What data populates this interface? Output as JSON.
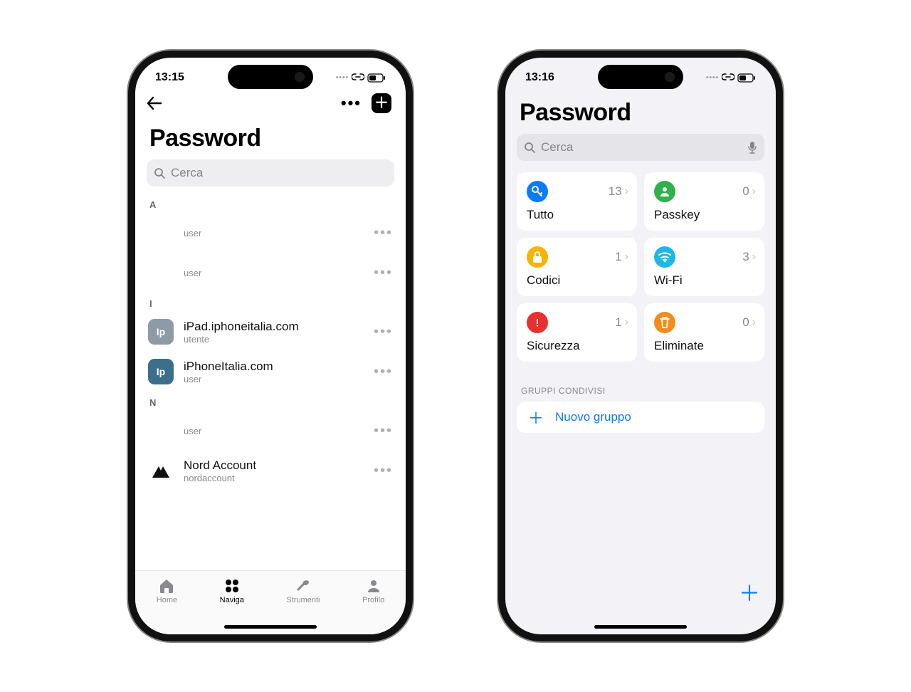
{
  "left": {
    "status": {
      "time": "13:15"
    },
    "title": "Password",
    "search_placeholder": "Cerca",
    "sections": [
      {
        "letter": "A",
        "items": [
          {
            "title": "",
            "sub": "user",
            "icon_bg": "",
            "icon_text": ""
          },
          {
            "title": "",
            "sub": "user",
            "icon_bg": "",
            "icon_text": ""
          }
        ]
      },
      {
        "letter": "I",
        "items": [
          {
            "title": "iPad.iphoneitalia.com",
            "sub": "utente",
            "icon_bg": "#8e9aa6",
            "icon_text": "Ip"
          },
          {
            "title": "iPhoneItalia.com",
            "sub": "user",
            "icon_bg": "#3b6f8c",
            "icon_text": "Ip"
          }
        ]
      },
      {
        "letter": "N",
        "items": [
          {
            "title": "",
            "sub": "user",
            "icon_bg": "",
            "icon_text": ""
          },
          {
            "title": "Nord Account",
            "sub": "nordaccount",
            "icon_bg": "#ffffff",
            "icon_text": "nord"
          }
        ]
      }
    ],
    "tabs": [
      {
        "id": "home",
        "label": "Home",
        "active": false
      },
      {
        "id": "naviga",
        "label": "Naviga",
        "active": true
      },
      {
        "id": "strumenti",
        "label": "Strumenti",
        "active": false
      },
      {
        "id": "profilo",
        "label": "Profilo",
        "active": false
      }
    ]
  },
  "right": {
    "status": {
      "time": "13:16"
    },
    "title": "Password",
    "search_placeholder": "Cerca",
    "cards": [
      {
        "id": "tutto",
        "label": "Tutto",
        "count": "13",
        "color": "#0a7aff",
        "glyph": "key"
      },
      {
        "id": "passkey",
        "label": "Passkey",
        "count": "0",
        "color": "#30b14a",
        "glyph": "person"
      },
      {
        "id": "codici",
        "label": "Codici",
        "count": "1",
        "color": "#f5b400",
        "glyph": "lock"
      },
      {
        "id": "wifi",
        "label": "Wi-Fi",
        "count": "3",
        "color": "#1eb7e6",
        "glyph": "wifi"
      },
      {
        "id": "sicurezza",
        "label": "Sicurezza",
        "count": "1",
        "color": "#e8312f",
        "glyph": "alert"
      },
      {
        "id": "eliminate",
        "label": "Eliminate",
        "count": "0",
        "color": "#f28c1b",
        "glyph": "trash"
      }
    ],
    "groups_header": "GRUPPI CONDIVISI",
    "new_group_label": "Nuovo gruppo"
  }
}
